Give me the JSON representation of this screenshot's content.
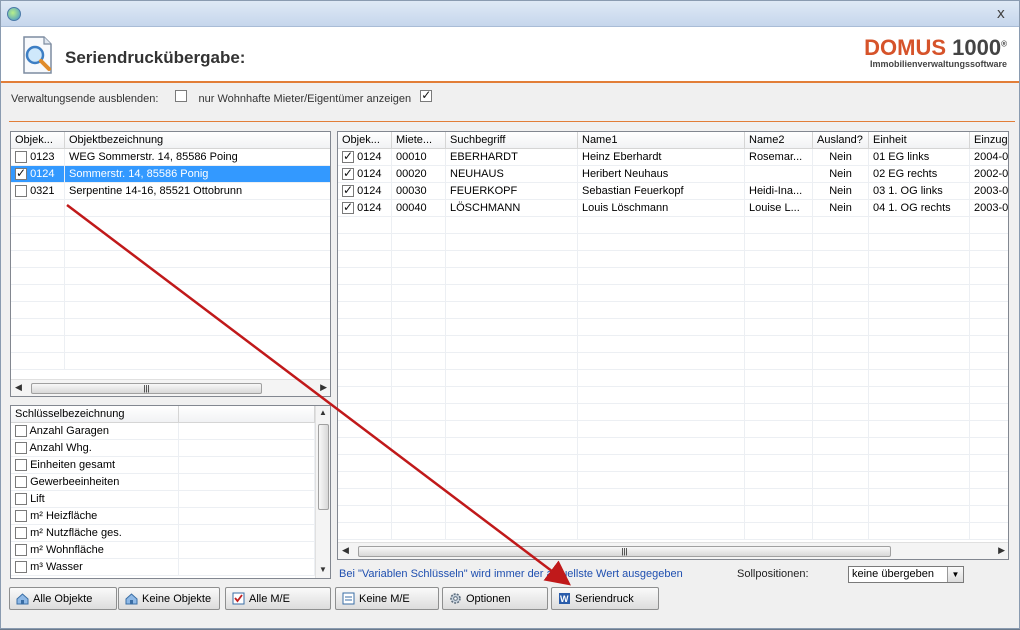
{
  "window": {
    "close_label": "x"
  },
  "header": {
    "title": "Seriendruckübergabe:",
    "logo_main_a": "DOMUS",
    "logo_main_b": "1000",
    "logo_reg": "®",
    "logo_sub": "Immobilienverwaltungssoftware"
  },
  "options": {
    "hide_label": "Verwaltungsende ausblenden:",
    "hide_checked": false,
    "residents_label": "nur Wohnhafte Mieter/Eigentümer anzeigen",
    "residents_checked": true
  },
  "objects_grid": {
    "headers": [
      "Objek...",
      "Objektbezeichnung"
    ],
    "rows": [
      {
        "checked": false,
        "nr": "0123",
        "name": "WEG Sommerstr. 14, 85586 Poing",
        "selected": false
      },
      {
        "checked": true,
        "nr": "0124",
        "name": "Sommerstr. 14, 85586 Ponig",
        "selected": true
      },
      {
        "checked": false,
        "nr": "0321",
        "name": "Serpentine 14-16, 85521 Ottobrunn",
        "selected": false
      }
    ]
  },
  "keys_grid": {
    "header": "Schlüsselbezeichnung",
    "items": [
      "Anzahl Garagen",
      "Anzahl Whg.",
      "Einheiten gesamt",
      "Gewerbeeinheiten",
      "Lift",
      "m² Heizfläche",
      "m² Nutzfläche ges.",
      "m² Wohnfläche",
      "m³ Wasser"
    ]
  },
  "tenants_grid": {
    "headers": [
      "Objek...",
      "Miete...",
      "Suchbegriff",
      "Name1",
      "Name2",
      "Ausland?",
      "Einheit",
      "Einzug"
    ],
    "rows": [
      {
        "checked": true,
        "obj": "0124",
        "mieter": "00010",
        "such": "EBERHARDT",
        "name1": "Heinz Eberhardt",
        "name2": "Rosemar...",
        "ausland": "Nein",
        "einheit": "01 EG links",
        "einzug": "2004-0"
      },
      {
        "checked": true,
        "obj": "0124",
        "mieter": "00020",
        "such": "NEUHAUS",
        "name1": "Heribert Neuhaus",
        "name2": "",
        "ausland": "Nein",
        "einheit": "02 EG rechts",
        "einzug": "2002-0"
      },
      {
        "checked": true,
        "obj": "0124",
        "mieter": "00030",
        "such": "FEUERKOPF",
        "name1": "Sebastian Feuerkopf",
        "name2": "Heidi-Ina...",
        "ausland": "Nein",
        "einheit": "03 1. OG links",
        "einzug": "2003-0"
      },
      {
        "checked": true,
        "obj": "0124",
        "mieter": "00040",
        "such": "LÖSCHMANN",
        "name1": "Louis Löschmann",
        "name2": "Louise L...",
        "ausland": "Nein",
        "einheit": "04 1. OG rechts",
        "einzug": "2003-0"
      }
    ]
  },
  "footer": {
    "info": "Bei \"Variablen Schlüsseln\" wird immer der aktuellste Wert ausgegeben",
    "soll_label": "Sollpositionen:",
    "soll_value": "keine übergeben"
  },
  "buttons": {
    "alle_objekte": "Alle Objekte",
    "keine_objekte": "Keine Objekte",
    "alle_me": "Alle M/E",
    "keine_me": "Keine  M/E",
    "optionen": "Optionen",
    "seriendruck": "Seriendruck"
  },
  "colors": {
    "accent": "#e27e38",
    "selection": "#3399ff",
    "annotation_arrow": "#c0191a",
    "info_text": "#1f4fb0"
  },
  "icons": [
    "app-icon",
    "document-search-icon",
    "home-icon",
    "checklist-icon",
    "gear-icon",
    "word-icon"
  ]
}
